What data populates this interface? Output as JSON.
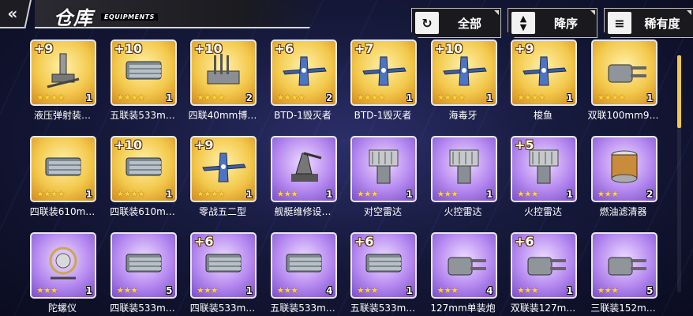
{
  "header": {
    "back_icon": "back-arrow-icon",
    "title": "仓库",
    "subtitle": "EQUIPMENTS"
  },
  "toolbar": {
    "all_label": "全部",
    "sort_label": "降序",
    "rarity_label": "稀有度"
  },
  "items": [
    {
      "name": "液压弹射装…",
      "plus": "+9",
      "stars": "★★★★",
      "count": "1",
      "frame": "gold",
      "icon": "catapult-icon"
    },
    {
      "name": "五联装533m…",
      "plus": "+10",
      "stars": "★★★★",
      "count": "1",
      "frame": "gold",
      "icon": "torpedo-launcher-icon"
    },
    {
      "name": "四联40mm博…",
      "plus": "+10",
      "stars": "★★★★",
      "count": "2",
      "frame": "gold",
      "icon": "aa-gun-icon"
    },
    {
      "name": "BTD-1毁灭者",
      "plus": "+6",
      "stars": "★★★★",
      "count": "2",
      "frame": "gold",
      "icon": "plane-icon"
    },
    {
      "name": "BTD-1毁灭者",
      "plus": "+7",
      "stars": "★★★★",
      "count": "1",
      "frame": "gold",
      "icon": "plane-icon"
    },
    {
      "name": "海毒牙",
      "plus": "+10",
      "stars": "★★★★",
      "count": "1",
      "frame": "gold",
      "icon": "plane-icon"
    },
    {
      "name": "梭鱼",
      "plus": "+9",
      "stars": "★★★★",
      "count": "1",
      "frame": "gold",
      "icon": "plane-icon"
    },
    {
      "name": "双联100mm9…",
      "plus": "",
      "stars": "★★★★",
      "count": "1",
      "frame": "gold",
      "icon": "turret-icon"
    },
    {
      "name": "四联装610m…",
      "plus": "",
      "stars": "★★★★",
      "count": "1",
      "frame": "gold",
      "icon": "torpedo-launcher-icon"
    },
    {
      "name": "四联装610m…",
      "plus": "+10",
      "stars": "★★★★",
      "count": "1",
      "frame": "gold",
      "icon": "torpedo-launcher-icon"
    },
    {
      "name": "零战五二型",
      "plus": "+9",
      "stars": "★★★★",
      "count": "1",
      "frame": "gold",
      "icon": "plane-icon"
    },
    {
      "name": "舰艇维修设…",
      "plus": "",
      "stars": "★★★",
      "count": "1",
      "frame": "purple",
      "icon": "repair-crane-icon"
    },
    {
      "name": "对空雷达",
      "plus": "",
      "stars": "★★★",
      "count": "1",
      "frame": "purple",
      "icon": "radar-icon"
    },
    {
      "name": "火控雷达",
      "plus": "",
      "stars": "★★★",
      "count": "1",
      "frame": "purple",
      "icon": "radar-icon"
    },
    {
      "name": "火控雷达",
      "plus": "+5",
      "stars": "★★★",
      "count": "1",
      "frame": "purple",
      "icon": "radar-icon"
    },
    {
      "name": "燃油滤清器",
      "plus": "",
      "stars": "★★★",
      "count": "2",
      "frame": "purple",
      "icon": "fuel-filter-icon"
    },
    {
      "name": "陀螺仪",
      "plus": "",
      "stars": "★★★",
      "count": "1",
      "frame": "purple",
      "icon": "gyroscope-icon"
    },
    {
      "name": "四联装533m…",
      "plus": "",
      "stars": "★★★",
      "count": "5",
      "frame": "purple",
      "icon": "torpedo-launcher-icon"
    },
    {
      "name": "四联装533m…",
      "plus": "+6",
      "stars": "★★★",
      "count": "1",
      "frame": "purple",
      "icon": "torpedo-launcher-icon"
    },
    {
      "name": "五联装533m…",
      "plus": "",
      "stars": "★★★",
      "count": "4",
      "frame": "purple",
      "icon": "torpedo-launcher-icon"
    },
    {
      "name": "五联装533m…",
      "plus": "+6",
      "stars": "★★★",
      "count": "1",
      "frame": "purple",
      "icon": "torpedo-launcher-icon"
    },
    {
      "name": "127mm单装炮",
      "plus": "",
      "stars": "★★★",
      "count": "4",
      "frame": "purple",
      "icon": "turret-icon"
    },
    {
      "name": "双联装127m…",
      "plus": "+6",
      "stars": "★★★",
      "count": "1",
      "frame": "purple",
      "icon": "turret-icon"
    },
    {
      "name": "三联装152m…",
      "plus": "",
      "stars": "★★★",
      "count": "5",
      "frame": "purple",
      "icon": "turret-icon"
    }
  ]
}
